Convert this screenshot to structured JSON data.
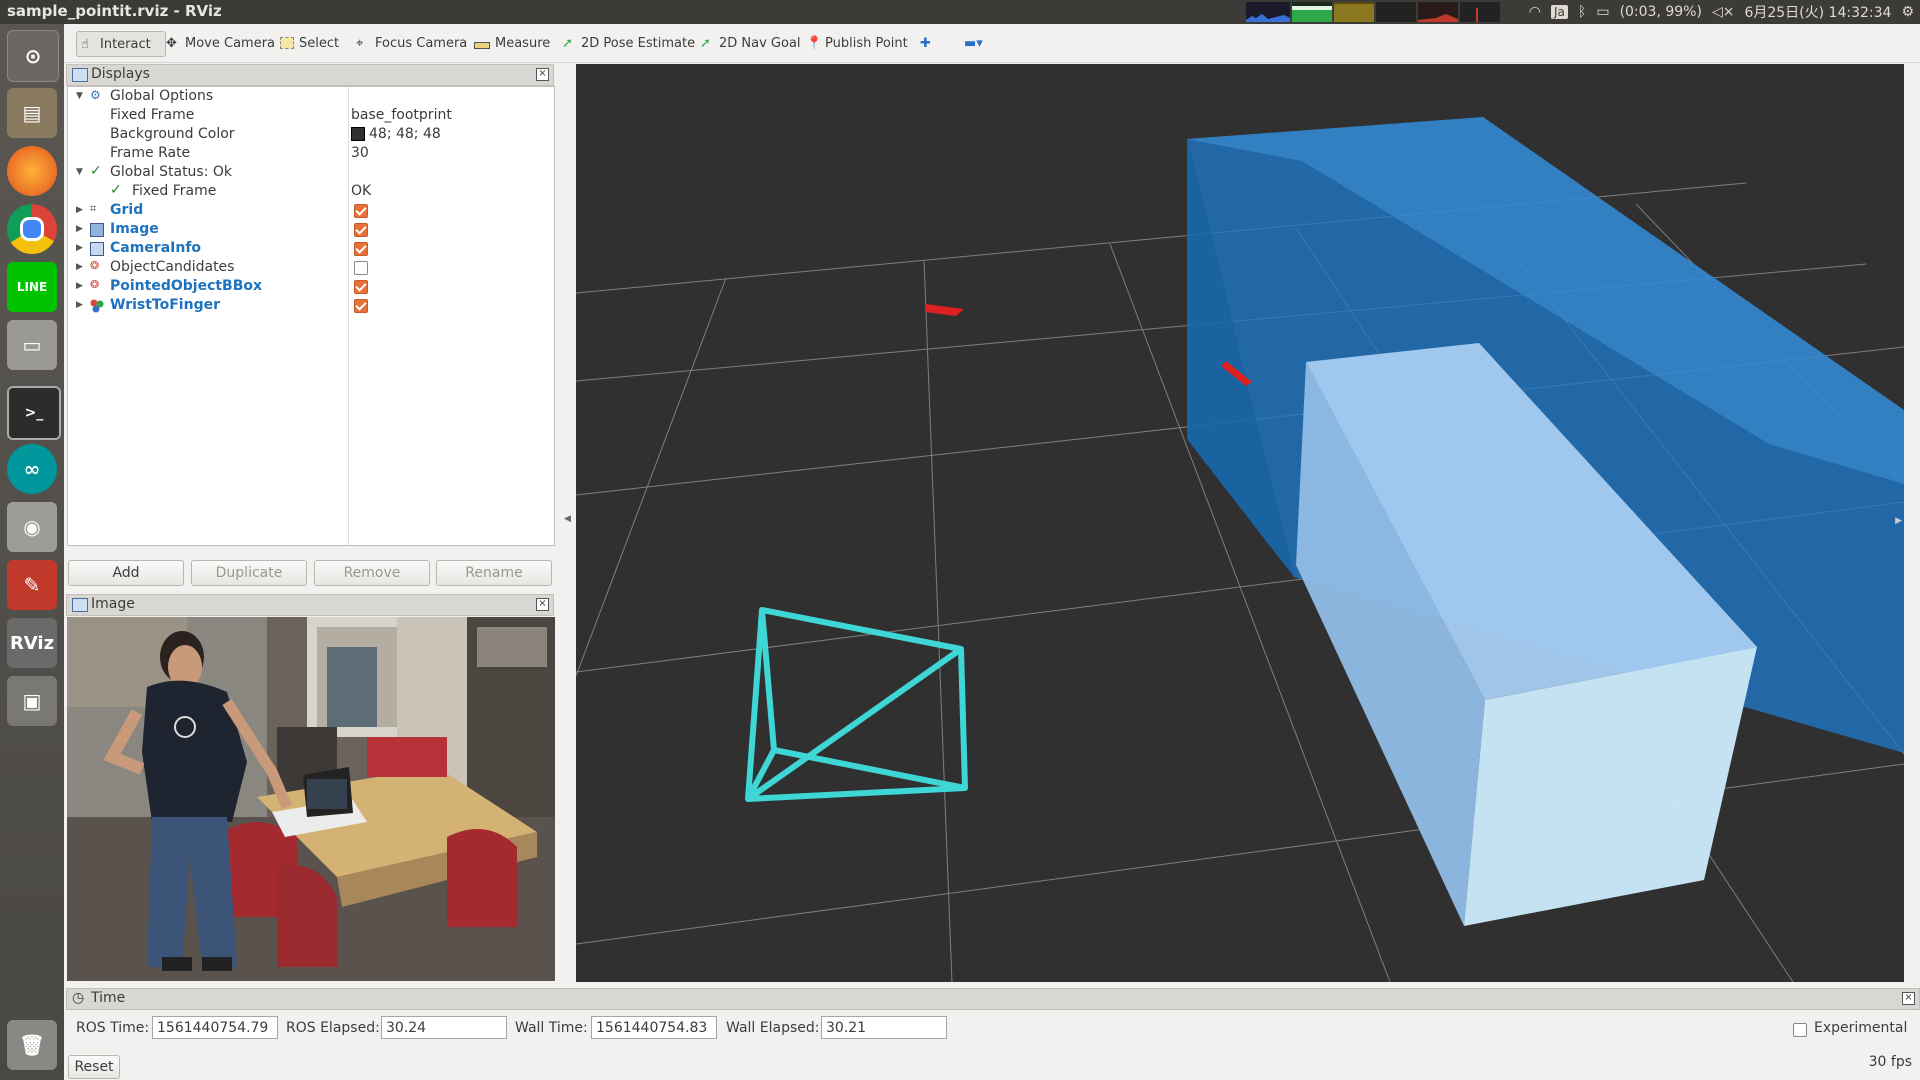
{
  "window": {
    "title": "sample_pointit.rviz - RViz"
  },
  "tray": {
    "battery": "(0:03, 99%)",
    "lang": "Ja",
    "datetime": "6月25日(火) 14:32:34"
  },
  "toolbar": {
    "interact": "Interact",
    "move_camera": "Move Camera",
    "select": "Select",
    "focus_camera": "Focus Camera",
    "measure": "Measure",
    "pose_estimate": "2D Pose Estimate",
    "nav_goal": "2D Nav Goal",
    "publish_point": "Publish Point"
  },
  "displays": {
    "title": "Displays",
    "global_options": "Global Options",
    "fixed_frame_label": "Fixed Frame",
    "fixed_frame_value": "base_footprint",
    "bg_color_label": "Background Color",
    "bg_color_value": "48; 48; 48",
    "frame_rate_label": "Frame Rate",
    "frame_rate_value": "30",
    "global_status": "Global Status: Ok",
    "fixed_frame_status_label": "Fixed Frame",
    "fixed_frame_status_value": "OK",
    "items": [
      {
        "label": "Grid",
        "enabled": true
      },
      {
        "label": "Image",
        "enabled": true
      },
      {
        "label": "CameraInfo",
        "enabled": true
      },
      {
        "label": "ObjectCandidates",
        "enabled": false
      },
      {
        "label": "PointedObjectBBox",
        "enabled": true
      },
      {
        "label": "WristToFinger",
        "enabled": true
      }
    ],
    "buttons": {
      "add": "Add",
      "duplicate": "Duplicate",
      "remove": "Remove",
      "rename": "Rename"
    }
  },
  "image_panel": {
    "title": "Image"
  },
  "time_panel": {
    "title": "Time",
    "ros_time_label": "ROS Time:",
    "ros_time": "1561440754.79",
    "ros_elapsed_label": "ROS Elapsed:",
    "ros_elapsed": "30.24",
    "wall_time_label": "Wall Time:",
    "wall_time": "1561440754.83",
    "wall_elapsed_label": "Wall Elapsed:",
    "wall_elapsed": "30.21",
    "experimental": "Experimental",
    "reset": "Reset",
    "fps": "30 fps"
  },
  "colors": {
    "background": "#303030",
    "accent": "#e8713a",
    "link": "#1e73be",
    "box": "#1f78c8",
    "frustum": "#3fd6d6"
  }
}
